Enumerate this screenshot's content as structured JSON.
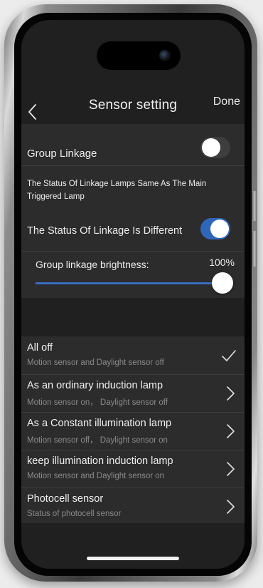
{
  "header": {
    "title": "Sensor setting",
    "done_label": "Done",
    "back_icon": "chevron-left-icon"
  },
  "settings": {
    "group_linkage": {
      "label": "Group Linkage",
      "enabled": false
    },
    "same_status_text": "The Status Of Linkage Lamps Same As The Main Triggered Lamp",
    "different_status": {
      "label": "The Status Of Linkage Is Different",
      "enabled": true
    },
    "brightness": {
      "label": "Group linkage brightness:",
      "value_text": "100%",
      "value": 100
    }
  },
  "modes": [
    {
      "title": "All off",
      "subtitle": "Motion sensor and Daylight sensor off",
      "icon": "checkmark-icon",
      "selected": true
    },
    {
      "title": "As an ordinary induction lamp",
      "subtitle": "Motion sensor on， Daylight sensor off",
      "icon": "chevron-right-icon",
      "selected": false
    },
    {
      "title": "As a Constant illumination lamp",
      "subtitle": "Motion sensor off， Daylight sensor on",
      "icon": "chevron-right-icon",
      "selected": false
    },
    {
      "title": "keep illumination induction lamp",
      "subtitle": "Motion sensor and Daylight sensor on",
      "icon": "chevron-right-icon",
      "selected": false
    },
    {
      "title": "Photocell sensor",
      "subtitle": "Status of photocell sensor",
      "icon": "chevron-right-icon",
      "selected": false
    }
  ],
  "colors": {
    "accent": "#3066ba",
    "background": "#202020",
    "card": "#2c2c2c",
    "text": "#ececec",
    "subtext": "#8a8a8a"
  }
}
